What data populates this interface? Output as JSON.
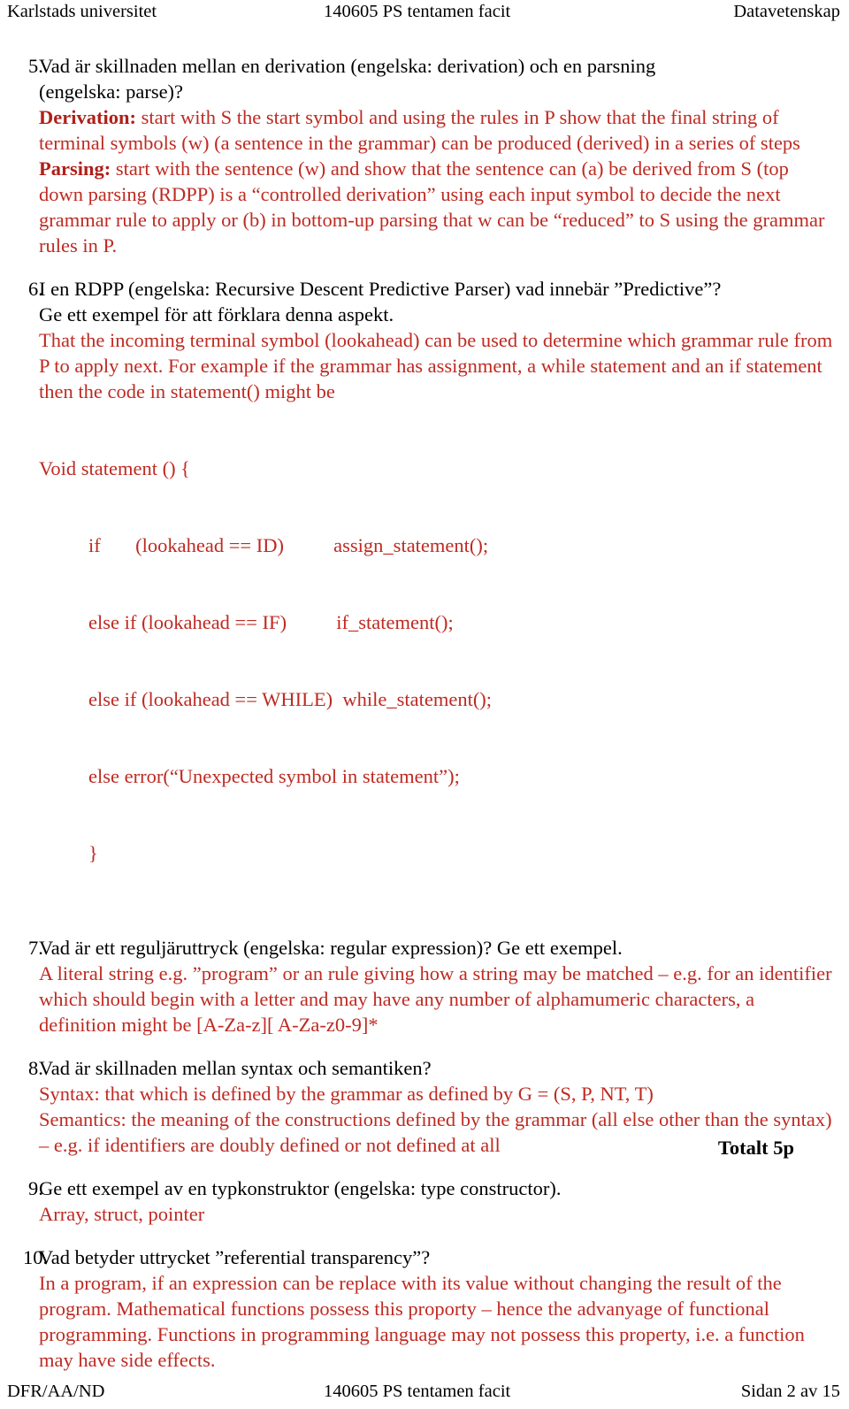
{
  "header": {
    "left": "Karlstads universitet",
    "middle": "140605 PS tentamen facit",
    "right": "Datavetenskap"
  },
  "footer": {
    "left": "DFR/AA/ND",
    "middle": "140605 PS tentamen facit",
    "right": "Sidan 2 av 15"
  },
  "questions": [
    {
      "number": "5.",
      "question_lines": [
        "Vad är skillnaden mellan en derivation (engelska: derivation) och en parsning",
        "(engelska:  parse)?"
      ],
      "answer_lead_1": "Derivation:",
      "answer_body_1": " start with S the start symbol and using the rules in P show that the final string of terminal symbols (w) (a sentence in the grammar) can be produced (derived) in a series of steps",
      "answer_lead_2": "Parsing:",
      "answer_body_2": " start with the sentence (w) and show that the sentence can (a) be derived from S (top down parsing (RDPP) is a “controlled derivation” using each input symbol to decide the next grammar rule to apply or (b) in bottom-up parsing that w can be “reduced” to S using the grammar rules in P."
    },
    {
      "number": "6.",
      "question_lines": [
        "I en RDPP (engelska: Recursive Descent Predictive Parser) vad innebär ”Predictive”?",
        "Ge ett exempel för att förklara denna aspekt."
      ],
      "answer_paragraph": "That the incoming terminal symbol (lookahead) can be used to determine which grammar rule from P to apply next. For example if the grammar has assignment,  a while statement and an if statement then the code in statement() might be",
      "code_lines": [
        {
          "text": "Void statement () {",
          "indent": false
        },
        {
          "text": "if       (lookahead == ID)          assign_statement();",
          "indent": true
        },
        {
          "text": "else if (lookahead == IF)          if_statement();",
          "indent": true
        },
        {
          "text": "else if (lookahead == WHILE)  while_statement();",
          "indent": true
        },
        {
          "text": "else error(“Unexpected symbol in statement”);",
          "indent": true
        },
        {
          "text": "}",
          "indent": true
        }
      ]
    },
    {
      "number": "7.",
      "question_lines": [
        "Vad är ett reguljäruttryck (engelska: regular expression)?  Ge ett exempel."
      ],
      "answer_paragraph": "A literal string e.g. ”program” or an rule giving how a string may be matched – e.g. for an identifier which should begin with a letter and may have any number of alphamumeric characters, a definition might be [A-Za-z][ A-Za-z0-9]*"
    },
    {
      "number": "8.",
      "question_lines": [
        "Vad är skillnaden mellan syntax och semantiken?"
      ],
      "answer_line_1": "Syntax: that which is defined by the grammar as defined by G = (S, P, NT, T)",
      "answer_paragraph": "Semantics: the meaning of the constructions defined by the grammar (all else other than the syntax) – e.g. if identifiers are doubly defined or not defined at all"
    },
    {
      "number": "9.",
      "question_lines": [
        "Ge ett exempel av en typkonstruktor (engelska: type constructor)."
      ],
      "answer_paragraph": "Array, struct, pointer"
    },
    {
      "number": "10.",
      "question_lines": [
        "Vad betyder uttrycket ”referential transparency”?"
      ],
      "answer_paragraph": "In a program, if an expression can be replace with its value without changing the result of the program. Mathematical functions possess this proporty – hence the advanyage of functional programming. Functions in programming language may not possess this property, i.e. a function may have side effects."
    }
  ],
  "totals": "Totalt 5p",
  "colors": {
    "answer_red": "#BE2A22",
    "lead_red": "#B01F18",
    "text_black": "#000000",
    "page_background": "#FFFFFF"
  }
}
